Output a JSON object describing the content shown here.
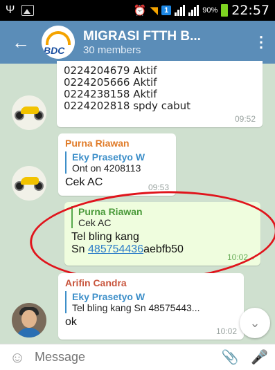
{
  "status_bar": {
    "battery": "90%",
    "time": "22:57"
  },
  "header": {
    "title": "MIGRASI FTTH B...",
    "subtitle": "30 members",
    "logo_text": "BDC"
  },
  "messages": {
    "m1": {
      "lines": [
        "0224204679 Aktif",
        "0224205666 Aktif",
        "0224238158 Aktif",
        "0224202818 spdy cabut"
      ],
      "time": "09:52"
    },
    "m2": {
      "sender": "Purna Riawan",
      "reply_name": "Eky Prasetyo W",
      "reply_text": "Ont on 4208113",
      "text": "Cek AC",
      "time": "09:53"
    },
    "m3": {
      "reply_name": "Purna Riawan",
      "reply_text": "Cek AC",
      "line1": "Tel bling kang",
      "sn_prefix": "Sn ",
      "sn_link": "485754436",
      "sn_suffix": "aebfb50",
      "time": "10:02"
    },
    "m4": {
      "sender": "Arifin Candra",
      "reply_name": "Eky Prasetyo W",
      "reply_text": "Tel bling kang  Sn 48575443...",
      "text": "ok",
      "time": "10:02"
    }
  },
  "composer": {
    "placeholder": "Message"
  },
  "colors": {
    "header": "#5b8db8",
    "accent_green": "#4a9a3a",
    "highlight_ring": "#e0141c"
  }
}
